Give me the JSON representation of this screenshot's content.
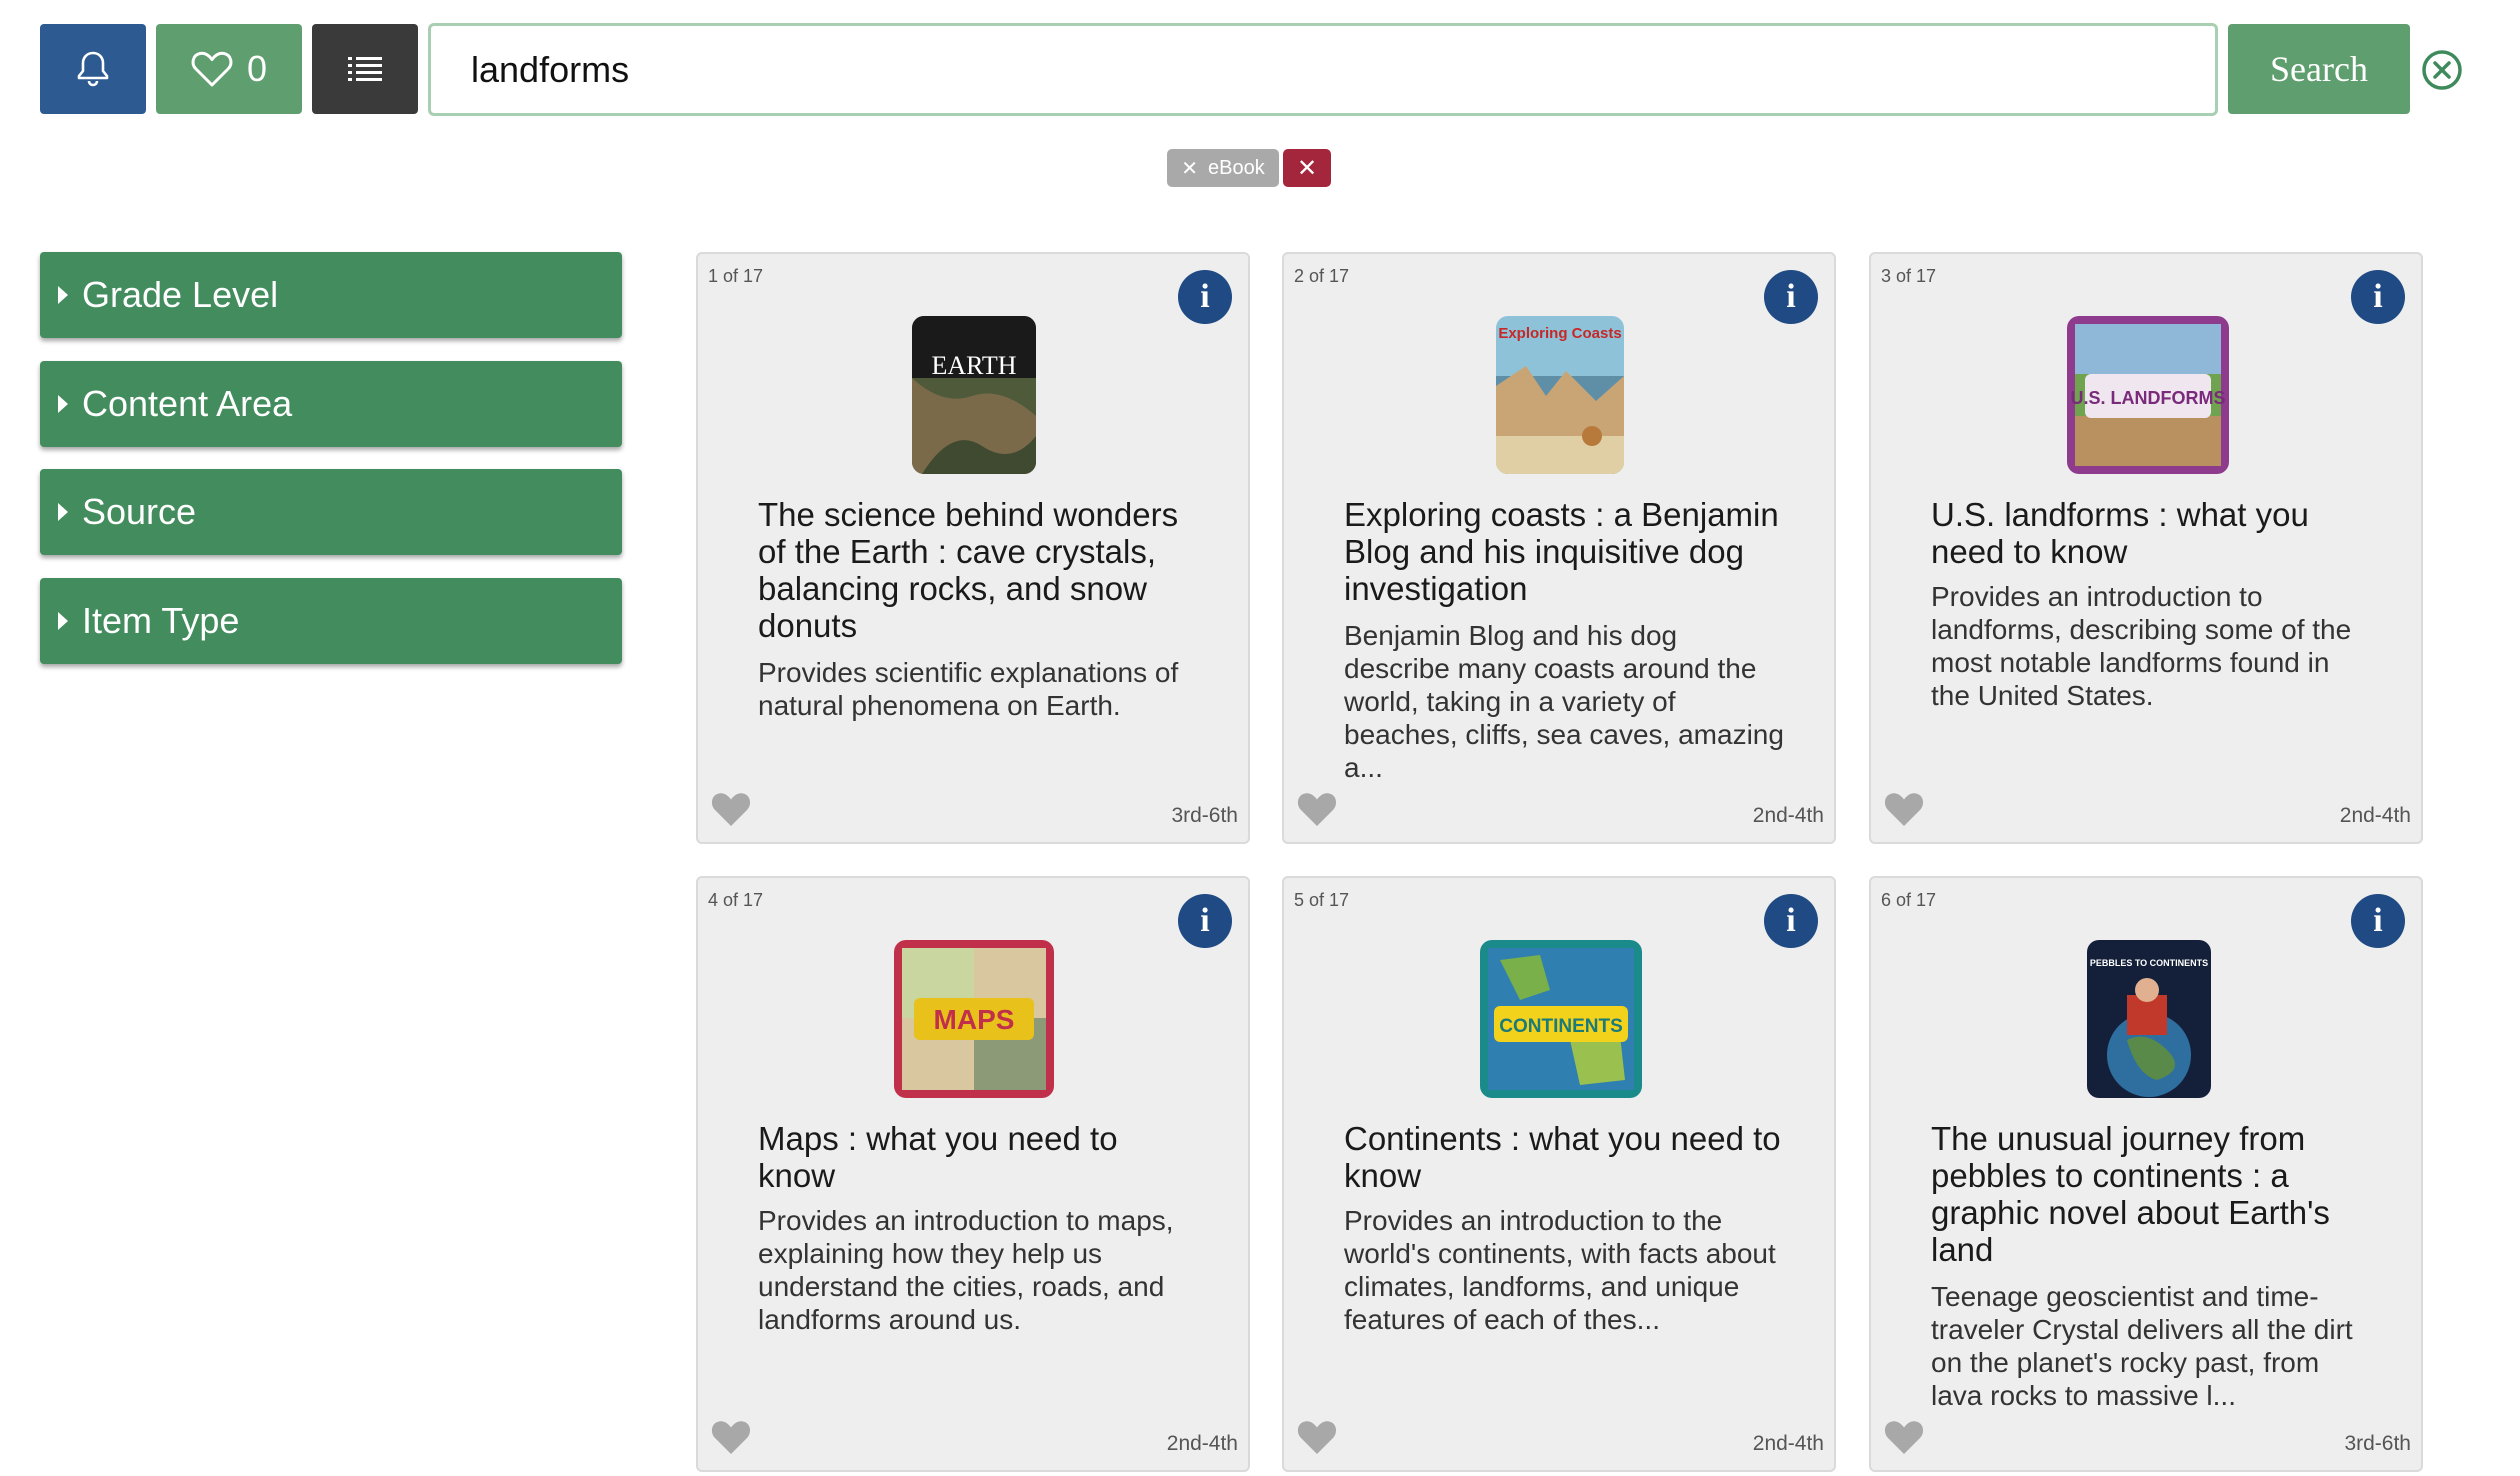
{
  "header": {
    "favorites_count": "0",
    "search_value": "landforms",
    "search_label": "Search",
    "icons": {
      "notifications": "bell-icon",
      "favorites": "heart-icon",
      "list": "list-icon",
      "clear": "close-circle-icon"
    }
  },
  "filters": {
    "chips": [
      {
        "label": "eBook"
      }
    ],
    "clear_all_icon": "close-icon"
  },
  "sidebar": {
    "facets": [
      {
        "label": "Grade Level"
      },
      {
        "label": "Content Area"
      },
      {
        "label": "Source"
      },
      {
        "label": "Item Type"
      }
    ]
  },
  "results": {
    "items": [
      {
        "position": "1 of 17",
        "title": "The science behind wonders of the Earth : cave crystals, balancing rocks, and snow donuts",
        "description": "Provides scientific explanations of natural phenomena on Earth.",
        "grade": "3rd-6th",
        "cover_text": "EARTH"
      },
      {
        "position": "2 of 17",
        "title": "Exploring coasts : a Benjamin Blog and his inquisitive dog investigation",
        "description": "Benjamin Blog and his dog describe many coasts around the world, taking in a variety of beaches, cliffs, sea caves, amazing a...",
        "grade": "2nd-4th",
        "cover_text": "Exploring Coasts"
      },
      {
        "position": "3 of 17",
        "title": "U.S. landforms : what you need to know",
        "description": "Provides an introduction to landforms, describing some of the most notable landforms found in the United States.",
        "grade": "2nd-4th",
        "cover_text": "U.S. LANDFORMS"
      },
      {
        "position": "4 of 17",
        "title": "Maps : what you need to know",
        "description": "Provides an introduction to maps, explaining how they help us understand the cities, roads, and landforms around us.",
        "grade": "2nd-4th",
        "cover_text": "MAPS"
      },
      {
        "position": "5 of 17",
        "title": "Continents : what you need to know",
        "description": "Provides an introduction to the world's continents, with facts about climates, landforms, and unique features of each of thes...",
        "grade": "2nd-4th",
        "cover_text": "CONTINENTS"
      },
      {
        "position": "6 of 17",
        "title": "The unusual journey from pebbles to continents : a graphic novel about Earth's land",
        "description": "Teenage geoscientist and time-traveler Crystal delivers all the dirt on the planet's rocky past, from lava rocks to massive l...",
        "grade": "3rd-6th",
        "cover_text": "PEBBLES TO CONTINENTS"
      }
    ],
    "info_label": "i"
  },
  "colors": {
    "primary_blue": "#2c5a91",
    "green": "#438c5e",
    "light_green": "#5f9e6e",
    "dark": "#3a3a3a",
    "red": "#a3263d"
  }
}
